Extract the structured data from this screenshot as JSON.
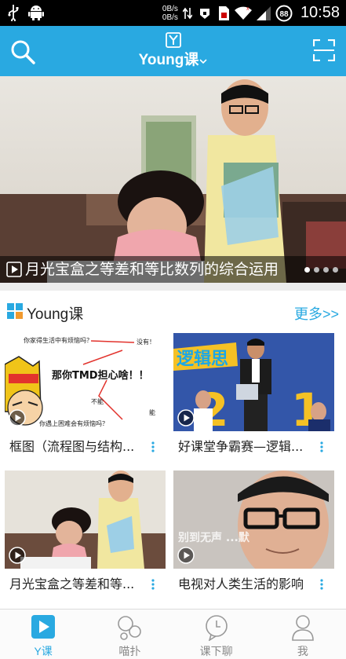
{
  "status_bar": {
    "speed_up": "0B/s",
    "speed_down": "0B/s",
    "battery": "88",
    "time": "10:58"
  },
  "header": {
    "logo_letter": "Y",
    "title": "Young课"
  },
  "banner": {
    "caption": "月光宝盒之等差和等比数列的综合运用",
    "slides": 4,
    "active_slide": 1
  },
  "section": {
    "title": "Young课",
    "more": "更多>>",
    "cards": [
      {
        "label": "框图（流程图与结构..."
      },
      {
        "label": "好课堂争霸赛—逻辑..."
      },
      {
        "label": "月光宝盒之等差和等..."
      },
      {
        "label": "电视对人类生活的影响"
      }
    ],
    "thumb_texts": {
      "q1": "你家得生活中有烦恼吗？",
      "a1": "没有！",
      "big": "那你TMD担心啥！！",
      "q2": "你遇上困难会有烦恼吗？",
      "no": "不能",
      "yes": "能",
      "show_title": "逻辑思",
      "num1": "2",
      "num2": "1",
      "tv_text": "别到无声 ...默"
    }
  },
  "tabs": [
    {
      "label": "Y课",
      "icon": "play-icon",
      "active": true
    },
    {
      "label": "喵扑",
      "icon": "bubbles-icon",
      "active": false
    },
    {
      "label": "课下聊",
      "icon": "chat-icon",
      "active": false
    },
    {
      "label": "我",
      "icon": "person-icon",
      "active": false
    }
  ],
  "colors": {
    "accent": "#29a9e1",
    "statusbar": "#000000"
  }
}
